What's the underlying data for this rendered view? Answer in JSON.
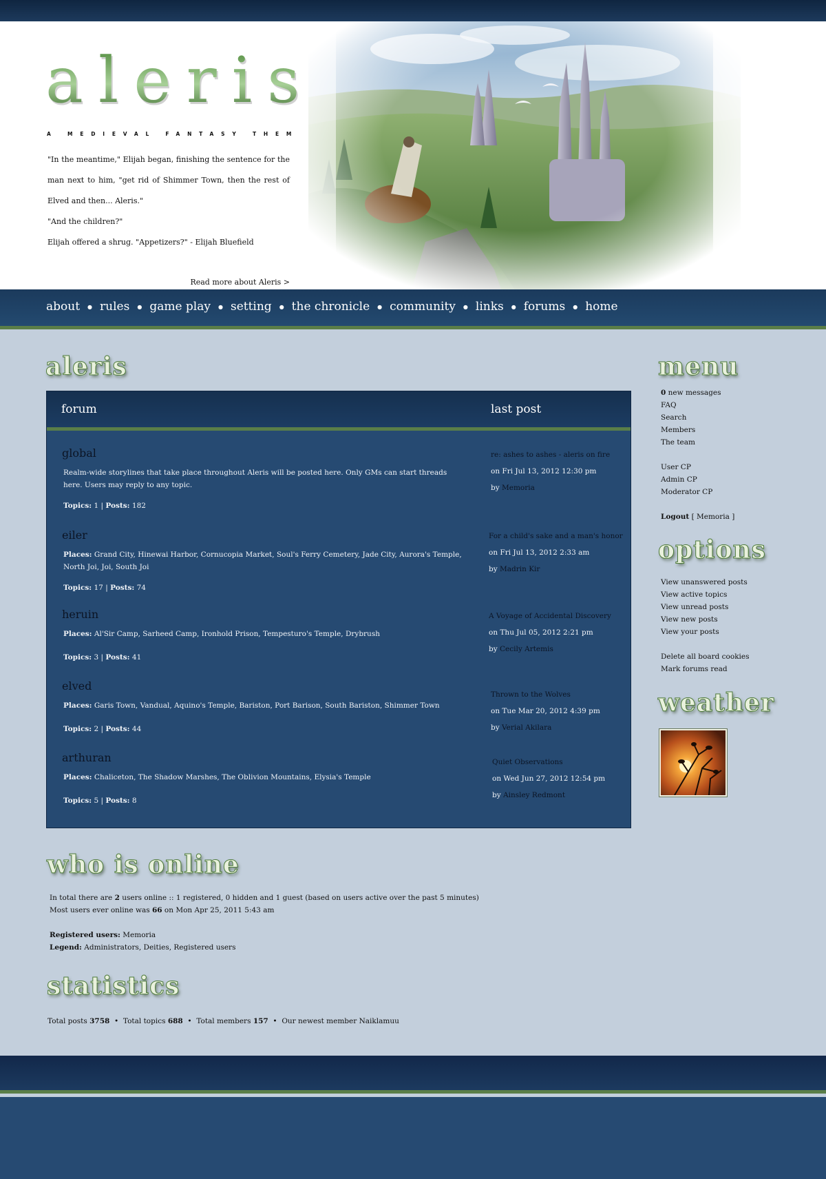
{
  "header": {
    "logo": "aleris",
    "tagline": "A MEDIEVAL FANTASY THEMED RPG",
    "quote": [
      "\"In the meantime,\" Elijah began, finishing the sentence for the man next to him, \"get rid of Shimmer Town, then the rest of Elved and then... Aleris.\"",
      "\"And the children?\"",
      "Elijah offered a shrug. \"Appetizers?\" - Elijah Bluefield"
    ],
    "read_more": "Read more about Aleris >"
  },
  "nav": {
    "items": [
      "about",
      "rules",
      "game play",
      "setting",
      "the chronicle",
      "community",
      "links",
      "forums",
      "home"
    ]
  },
  "main": {
    "title": "aleris",
    "columns": {
      "forum": "forum",
      "last_post": "last post"
    },
    "forums": [
      {
        "name": "global",
        "description": "Realm-wide storylines that take place throughout Aleris will be posted here. Only GMs can start threads here. Users may reply to any topic.",
        "places_label": "",
        "places": "",
        "topics": "1",
        "posts": "182",
        "last_title": "re: ashes to ashes - aleris on fire",
        "last_date": "on Fri Jul 13, 2012 12:30 pm",
        "last_user": "Memoria"
      },
      {
        "name": "eiler",
        "description": "",
        "places_label": "Places:",
        "places": "Grand City, Hinewai Harbor, Cornucopia Market, Soul's Ferry Cemetery, Jade City, Aurora's Temple, North Joi, Joi, South Joi",
        "topics": "17",
        "posts": "74",
        "last_title": "For a child's sake and a man's honor",
        "last_date": "on Fri Jul 13, 2012 2:33 am",
        "last_user": "Madrin Kir"
      },
      {
        "name": "heruin",
        "description": "",
        "places_label": "Places:",
        "places": "Al'Sir Camp, Sarheed Camp, Ironhold Prison, Tempesturo's Temple, Drybrush",
        "topics": "3",
        "posts": "41",
        "last_title": "A Voyage of Accidental Discovery",
        "last_date": "on Thu Jul 05, 2012 2:21 pm",
        "last_user": "Cecily Artemis"
      },
      {
        "name": "elved",
        "description": "",
        "places_label": "Places:",
        "places": "Garis Town, Vandual, Aquino's Temple, Bariston, Port Barison, South Bariston, Shimmer Town",
        "topics": "2",
        "posts": "44",
        "last_title": "Thrown to the Wolves",
        "last_date": "on Tue Mar 20, 2012 4:39 pm",
        "last_user": "Verial Akilara"
      },
      {
        "name": "arthuran",
        "description": "",
        "places_label": "Places:",
        "places": "Chaliceton, The Shadow Marshes, The Oblivion Mountains, Elysia's Temple",
        "topics": "5",
        "posts": "8",
        "last_title": "Quiet Observations",
        "last_date": "on Wed Jun 27, 2012 12:54 pm",
        "last_user": "Ainsley Redmont"
      }
    ],
    "labels": {
      "topics": "Topics:",
      "posts": "Posts:",
      "sep": "|",
      "by": "by"
    }
  },
  "sidebar": {
    "menu_title": "menu",
    "new_messages_count": "0",
    "new_messages_label": "new messages",
    "menu_items_1": [
      "FAQ",
      "Search",
      "Members",
      "The team"
    ],
    "menu_items_2": [
      "User CP",
      "Admin CP",
      "Moderator CP"
    ],
    "logout_label": "Logout",
    "logout_user": "[ Memoria ]",
    "options_title": "options",
    "options_1": [
      "View unanswered posts",
      "View active topics",
      "View unread posts",
      "View new posts",
      "View your posts"
    ],
    "options_2": [
      "Delete all board cookies",
      "Mark forums read"
    ],
    "weather_title": "weather"
  },
  "online": {
    "title": "who is online",
    "line1_pre": "In total there are",
    "line1_count": "2",
    "line1_post": "users online :: 1 registered, 0 hidden and 1 guest (based on users active over the past 5 minutes)",
    "line2_pre": "Most users ever online was",
    "line2_count": "66",
    "line2_post": "on Mon Apr 25, 2011 5:43 am",
    "registered_label": "Registered users:",
    "registered_value": "Memoria",
    "legend_label": "Legend:",
    "legend_value": "Administrators, Deities, Registered users"
  },
  "statistics": {
    "title": "statistics",
    "total_posts_label": "Total posts",
    "total_posts": "3758",
    "total_topics_label": "Total topics",
    "total_topics": "688",
    "total_members_label": "Total members",
    "total_members": "157",
    "newest_label": "Our newest member",
    "newest": "Naiklamuu",
    "bullet": "•"
  },
  "colors": {
    "navy": "#1b3a5c",
    "panel": "#264a72",
    "accent_green": "#5a7e48",
    "page_bg": "#c3cfdc"
  }
}
